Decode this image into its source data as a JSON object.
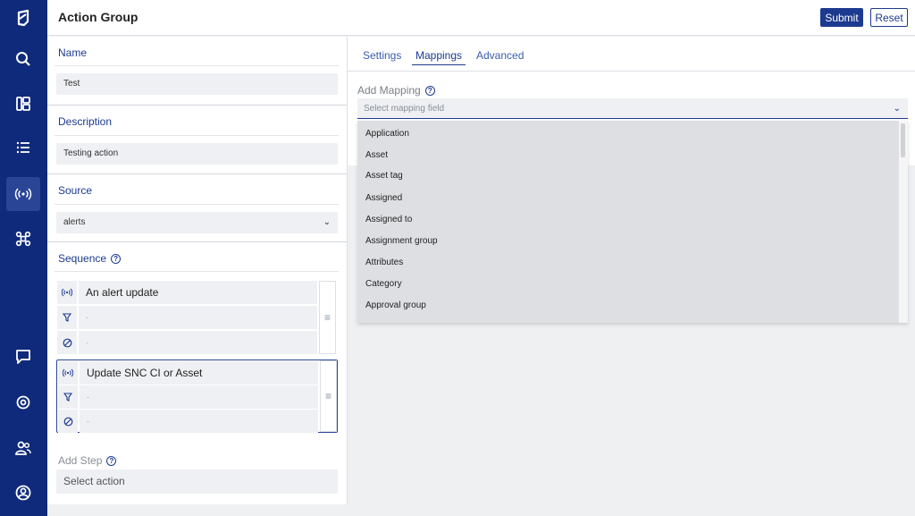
{
  "sidebar": {
    "items": [
      {
        "name": "logo-icon"
      },
      {
        "name": "search-icon"
      },
      {
        "name": "dashboard-icon"
      },
      {
        "name": "list-icon"
      },
      {
        "name": "broadcast-icon",
        "active": true
      },
      {
        "name": "network-icon"
      },
      {
        "name": "chat-icon"
      },
      {
        "name": "settings-icon"
      },
      {
        "name": "users-icon"
      },
      {
        "name": "account-icon"
      }
    ]
  },
  "header": {
    "title": "Action Group",
    "submit_label": "Submit",
    "reset_label": "Reset"
  },
  "left": {
    "name_label": "Name",
    "name_value": "Test",
    "description_label": "Description",
    "description_value": "Testing action",
    "source_label": "Source",
    "source_value": "alerts",
    "sequence_label": "Sequence",
    "steps": [
      {
        "trigger": "An alert update",
        "filter": "-",
        "exclude": "-"
      },
      {
        "trigger": "Update SNC CI or Asset",
        "filter": "-",
        "exclude": "-"
      }
    ],
    "add_step_label": "Add Step",
    "add_step_placeholder": "Select action"
  },
  "right": {
    "tabs": [
      "Settings",
      "Mappings",
      "Advanced"
    ],
    "active_tab": "Mappings",
    "add_mapping_label": "Add Mapping",
    "mapping_placeholder": "Select mapping field",
    "dropdown_options": [
      "Application",
      "Asset",
      "Asset tag",
      "Assigned",
      "Assigned to",
      "Assignment group",
      "Attributes",
      "Category",
      "Approval group"
    ]
  },
  "colors": {
    "sidebar_bg": "#0f2a7a",
    "accent": "#1c3a8f"
  }
}
